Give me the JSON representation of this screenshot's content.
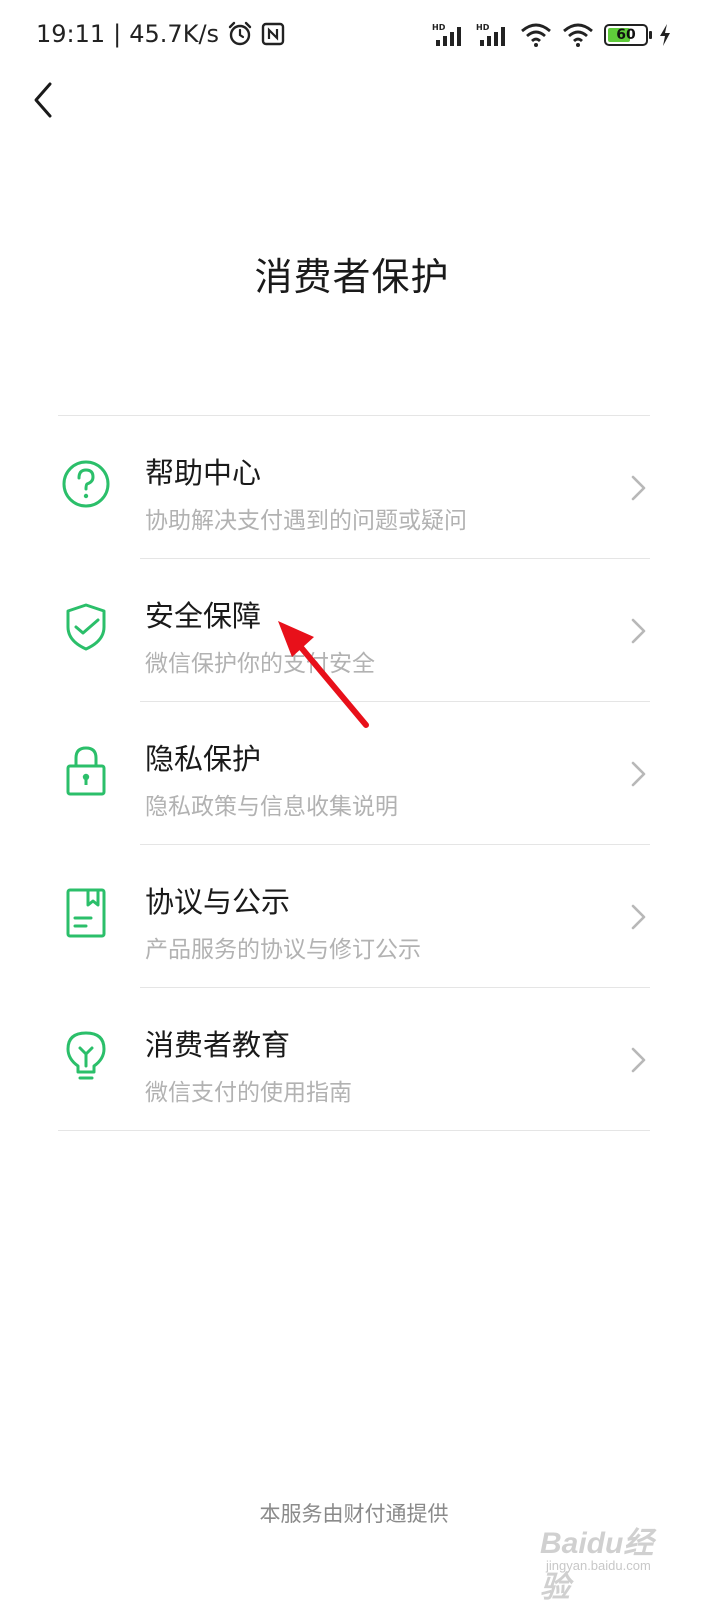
{
  "status_bar": {
    "time": "19:11",
    "separator": "|",
    "net_speed": "45.7K/s",
    "signal1_label": "HD",
    "signal2_label": "HD",
    "battery_level": "60",
    "icons": [
      "alarm-icon",
      "nfc-icon",
      "signal-icon",
      "wifi-icon",
      "battery-icon",
      "charging-icon"
    ]
  },
  "header": {
    "back_icon": "chevron-left-icon",
    "title": "消费者保护"
  },
  "menu": {
    "items": [
      {
        "title": "帮助中心",
        "subtitle": "协助解决支付遇到的问题或疑问",
        "icon": "question-circle-icon"
      },
      {
        "title": "安全保障",
        "subtitle": "微信保护你的支付安全",
        "icon": "shield-check-icon"
      },
      {
        "title": "隐私保护",
        "subtitle": "隐私政策与信息收集说明",
        "icon": "lock-icon"
      },
      {
        "title": "协议与公示",
        "subtitle": "产品服务的协议与修订公示",
        "icon": "document-icon"
      },
      {
        "title": "消费者教育",
        "subtitle": "微信支付的使用指南",
        "icon": "lightbulb-icon"
      }
    ]
  },
  "footer": {
    "text": "本服务由财付通提供"
  },
  "watermark": {
    "main": "Baidu经验",
    "sub": "jingyan.baidu.com"
  },
  "colors": {
    "accent": "#1aad19",
    "icon_green": "#2bbf6a",
    "annotation": "#e8101a",
    "subtitle": "#b2b2b2"
  }
}
